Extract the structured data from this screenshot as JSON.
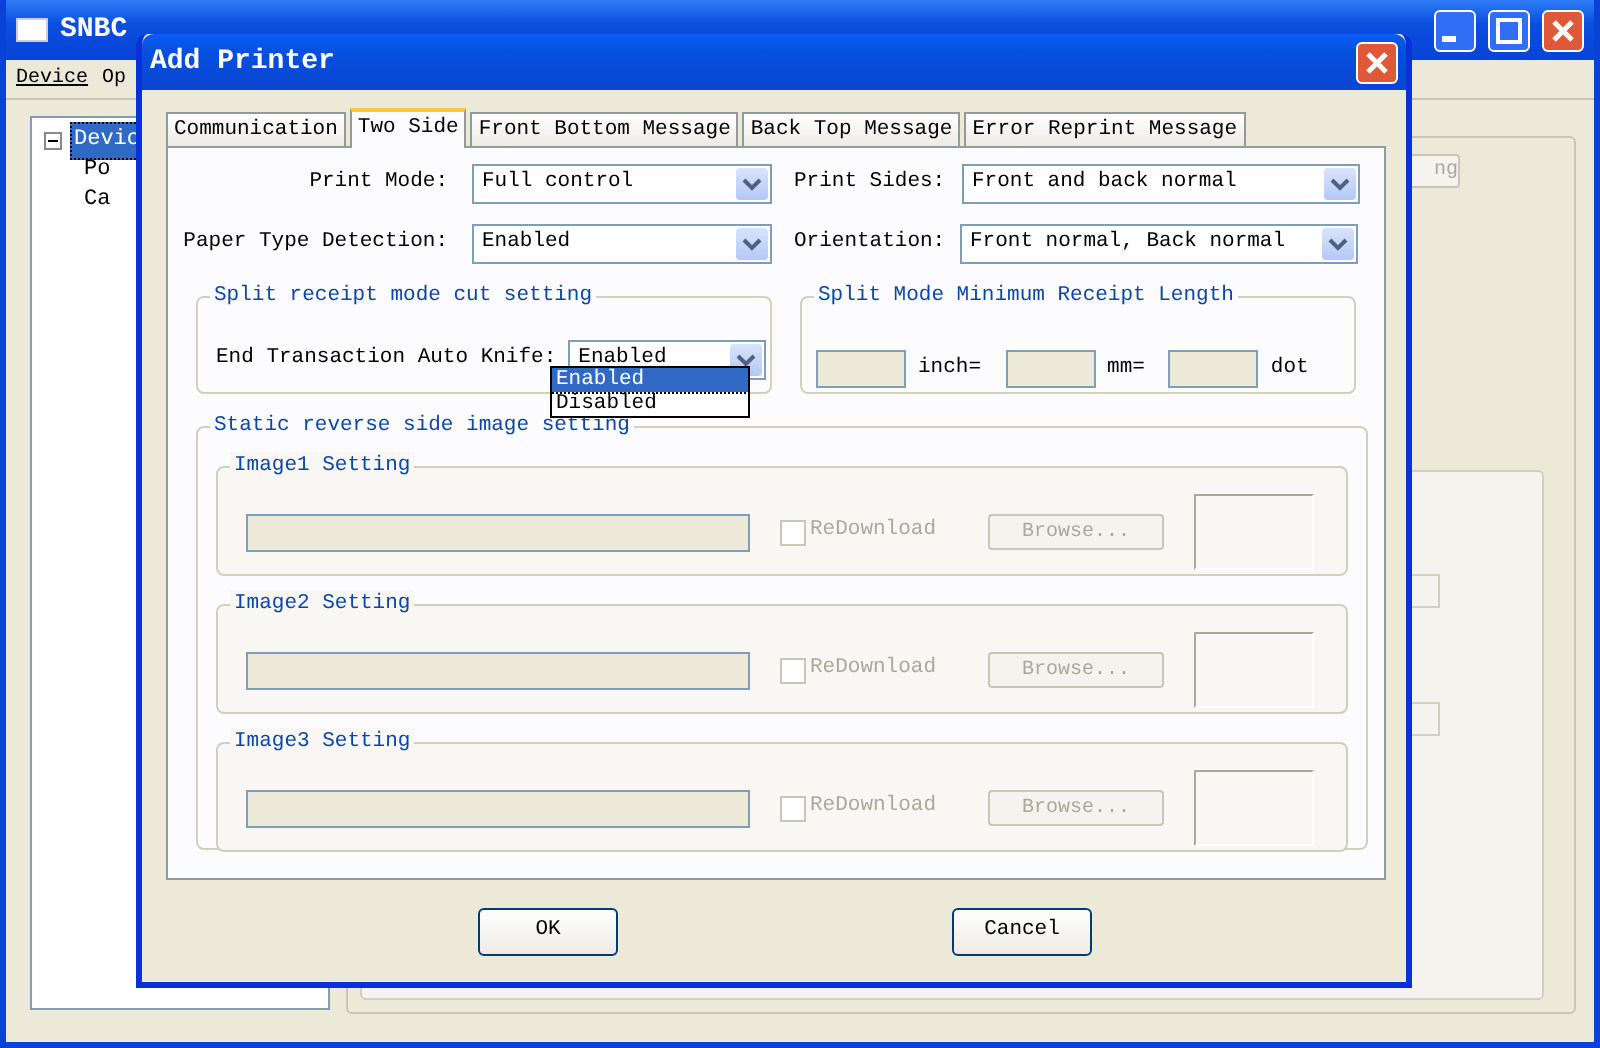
{
  "main_window": {
    "title": "SNBC",
    "menu": [
      {
        "label": "Device"
      },
      {
        "label": "Op"
      }
    ],
    "tree": [
      {
        "label": "Devic",
        "expanded": true,
        "selected": true,
        "children": [
          {
            "label": "Po"
          },
          {
            "label": "Ca"
          }
        ]
      }
    ],
    "side_button": "ng"
  },
  "dialog": {
    "title": "Add Printer",
    "tabs": [
      {
        "label": "Communication",
        "selected": false
      },
      {
        "label": "Two Side",
        "selected": true
      },
      {
        "label": "Front Bottom Message",
        "selected": false
      },
      {
        "label": "Back Top Message",
        "selected": false
      },
      {
        "label": "Error Reprint Message",
        "selected": false
      }
    ],
    "fields": [
      {
        "label": "Print Mode:",
        "value": "Full control"
      },
      {
        "label": "Print Sides:",
        "value": "Front and back normal"
      },
      {
        "label": "Paper Type Detection:",
        "value": "Enabled"
      },
      {
        "label": "Orientation:",
        "value": "Front normal, Back normal"
      }
    ],
    "cut_group": {
      "title": "Split receipt mode cut setting",
      "label": "End Transaction Auto Knife:",
      "value": "Enabled",
      "options": [
        {
          "label": "Enabled",
          "selected": true
        },
        {
          "label": "Disabled",
          "selected": false
        }
      ]
    },
    "length_group": {
      "title": "Split Mode Minimum Receipt Length",
      "units": [
        "inch=",
        "mm=",
        "dot"
      ]
    },
    "image_group": {
      "title": "Static reverse side image setting",
      "items": [
        {
          "title": "Image1 Setting",
          "checkbox": "ReDownload",
          "checked": false,
          "button": "Browse...",
          "disabled": true
        },
        {
          "title": "Image2 Setting",
          "checkbox": "ReDownload",
          "checked": false,
          "button": "Browse...",
          "disabled": true
        },
        {
          "title": "Image3 Setting",
          "checkbox": "ReDownload",
          "checked": false,
          "button": "Browse...",
          "disabled": true
        }
      ]
    },
    "buttons": [
      "OK",
      "Cancel"
    ]
  }
}
